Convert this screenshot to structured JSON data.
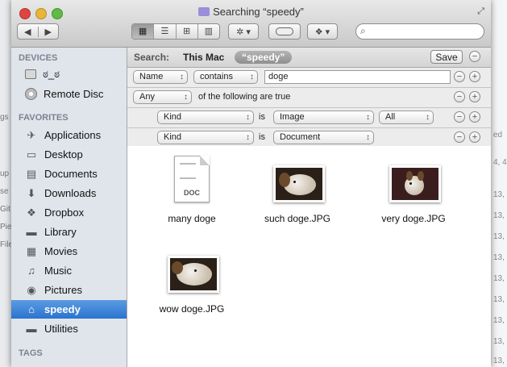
{
  "window": {
    "title": "Searching “speedy”",
    "fullscreen_icon": "fullscreen-arrows-icon"
  },
  "toolbar": {
    "back_icon": "◀",
    "forward_icon": "▶",
    "view_icon": "▦",
    "list_icon": "☰",
    "columns_icon": "⊞",
    "coverflow_icon": "▥",
    "action_icon": "✲ ▾",
    "dropbox_icon": "❖ ▾",
    "search_icon": "⌕",
    "search_value": ""
  },
  "sidebar": {
    "devices_header": "DEVICES",
    "devices": [
      {
        "label": "ಠ_ಠ",
        "icon": "hard-drive-icon"
      },
      {
        "label": "Remote Disc",
        "icon": "disc-icon"
      }
    ],
    "favorites_header": "FAVORITES",
    "favorites": [
      {
        "label": "Applications",
        "icon": "applications-icon",
        "glyph": "✈"
      },
      {
        "label": "Desktop",
        "icon": "desktop-icon",
        "glyph": "▭"
      },
      {
        "label": "Documents",
        "icon": "documents-icon",
        "glyph": "▤"
      },
      {
        "label": "Downloads",
        "icon": "downloads-icon",
        "glyph": "⬇"
      },
      {
        "label": "Dropbox",
        "icon": "dropbox-icon",
        "glyph": "❖"
      },
      {
        "label": "Library",
        "icon": "folder-icon",
        "glyph": "▬"
      },
      {
        "label": "Movies",
        "icon": "movies-icon",
        "glyph": "▦"
      },
      {
        "label": "Music",
        "icon": "music-icon",
        "glyph": "♫"
      },
      {
        "label": "Pictures",
        "icon": "pictures-icon",
        "glyph": "◉"
      },
      {
        "label": "speedy",
        "icon": "home-icon",
        "glyph": "⌂",
        "selected": true
      },
      {
        "label": "Utilities",
        "icon": "folder-icon",
        "glyph": "▬"
      }
    ],
    "tags_header": "TAGS"
  },
  "searchbar": {
    "search_label": "Search:",
    "this_mac": "This Mac",
    "scope": "“speedy”",
    "save_label": "Save"
  },
  "rules": [
    {
      "attr": "Name",
      "op": "contains",
      "value": "doge"
    },
    {
      "any": "Any",
      "text": "of the following are true"
    },
    {
      "attr": "Kind",
      "is": "is",
      "value": "Image",
      "extra": "All"
    },
    {
      "attr": "Kind",
      "is": "is",
      "value": "Document"
    }
  ],
  "rule_buttons": {
    "minus": "−",
    "plus": "+"
  },
  "files": [
    {
      "name": "many doge",
      "type": "doc",
      "ext": "DOC"
    },
    {
      "name": "such doge.JPG",
      "type": "image"
    },
    {
      "name": "very doge.JPG",
      "type": "image"
    },
    {
      "name": "wow doge.JPG",
      "type": "image"
    }
  ],
  "background": {
    "left_fragments": [
      "gs",
      "up",
      "se",
      "Git",
      "Pie",
      "File"
    ],
    "right_fragments": [
      "ed",
      "4, 4",
      "13,",
      "13,",
      "13,",
      "13,",
      "13,",
      "13,",
      "13,",
      "13,",
      "13,"
    ]
  },
  "colors": {
    "selection": "#2b73cf",
    "sidebar_bg": "#e0e5ec",
    "sidebar_header": "#7a8491"
  }
}
